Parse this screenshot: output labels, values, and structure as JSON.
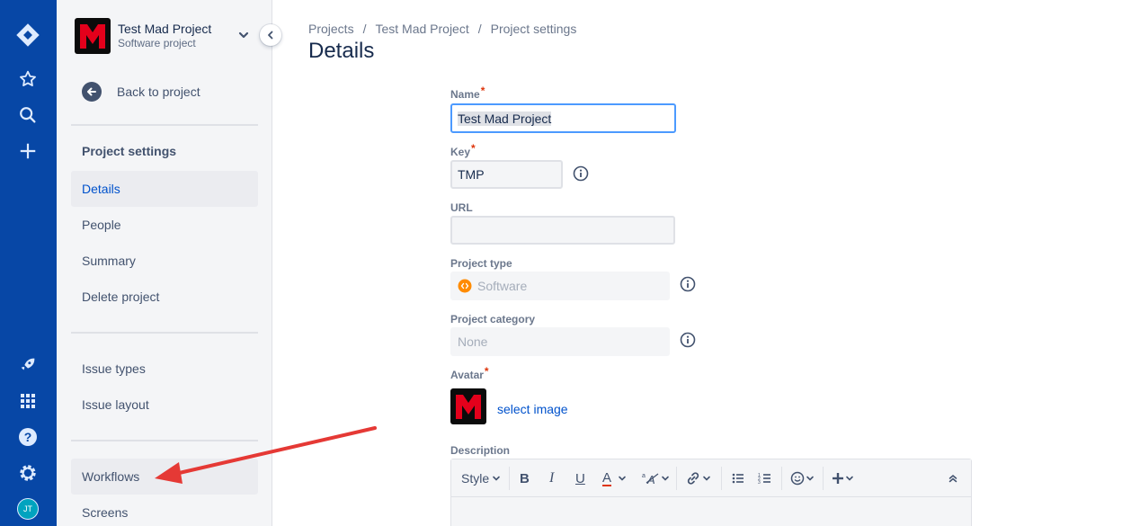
{
  "global_nav": {
    "user_initials": "JT",
    "colors": {
      "background": "#0747A6",
      "avatar": "#00A3BF"
    }
  },
  "sidebar": {
    "project_name": "Test Mad Project",
    "project_type": "Software project",
    "back_label": "Back to project",
    "section_title": "Project settings",
    "group1": [
      {
        "label": "Details",
        "selected": true
      },
      {
        "label": "People"
      },
      {
        "label": "Summary"
      },
      {
        "label": "Delete project"
      }
    ],
    "group2": [
      {
        "label": "Issue types"
      },
      {
        "label": "Issue layout"
      }
    ],
    "group3": [
      {
        "label": "Workflows"
      },
      {
        "label": "Screens"
      }
    ]
  },
  "breadcrumb": [
    "Projects",
    "Test Mad Project",
    "Project settings"
  ],
  "page_title": "Details",
  "form": {
    "name_label": "Name",
    "name_value": "Test Mad Project",
    "key_label": "Key",
    "key_value": "TMP",
    "url_label": "URL",
    "url_value": "",
    "project_type_label": "Project type",
    "project_type_value": "Software",
    "project_category_label": "Project category",
    "project_category_value": "None",
    "avatar_label": "Avatar",
    "select_image": "select image",
    "description_label": "Description",
    "required_marker": "*"
  },
  "editor_toolbar": {
    "style_label": "Style",
    "bold": "B",
    "italic": "I",
    "underline": "U",
    "text_color": "A"
  },
  "colors": {
    "accent": "#0052CC",
    "required": "#DE350B",
    "annotation_arrow": "#E53935",
    "software_icon": "#FF8B00"
  }
}
